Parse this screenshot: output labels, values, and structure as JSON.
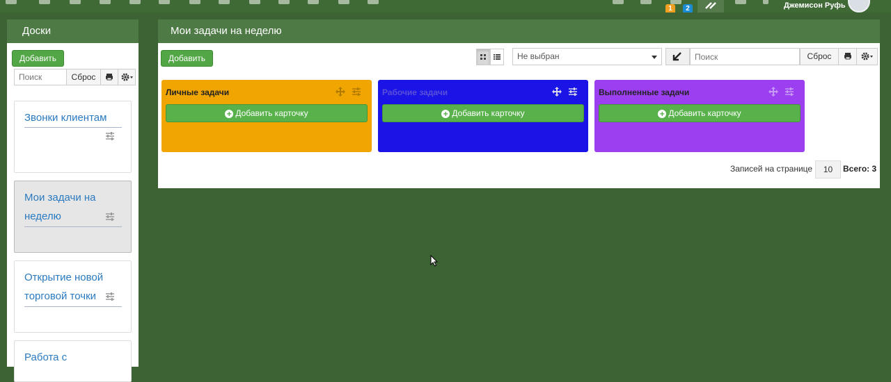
{
  "topbar": {
    "badges": [
      "1",
      "2"
    ],
    "user_name": "Джемисон Руфь"
  },
  "sidebar": {
    "title": "Доски",
    "add_label": "Добавить",
    "search_placeholder": "Поиск",
    "reset_label": "Сброс",
    "boards": [
      {
        "title": "Звонки клиентам",
        "selected": false
      },
      {
        "title": "Мои задачи на неделю",
        "selected": true
      },
      {
        "title": "Открытие новой торговой точки",
        "selected": false
      },
      {
        "title": "Работа с",
        "selected": false
      }
    ]
  },
  "main": {
    "title": "Мои задачи на неделю",
    "add_label": "Добавить",
    "filter_select": "Не выбран",
    "search_placeholder": "Поиск",
    "reset_label": "Сброс",
    "columns": [
      {
        "title": "Личные задачи",
        "color": "#f0a500",
        "add_card": "Добавить карточку"
      },
      {
        "title": "Рабочие задачи",
        "color": "#1a14e6",
        "add_card": "Добавить карточку"
      },
      {
        "title": "Выполненные задачи",
        "color": "#9b3ff0",
        "add_card": "Добавить карточку"
      }
    ],
    "pager": {
      "per_page_label": "Записей на странице",
      "per_page_value": "10",
      "total_label": "Всего: 3"
    }
  },
  "colors": {
    "background": "#3d6233",
    "header": "#4d7a45",
    "button_green": "#52a645",
    "link_blue": "#2a7ac0"
  }
}
